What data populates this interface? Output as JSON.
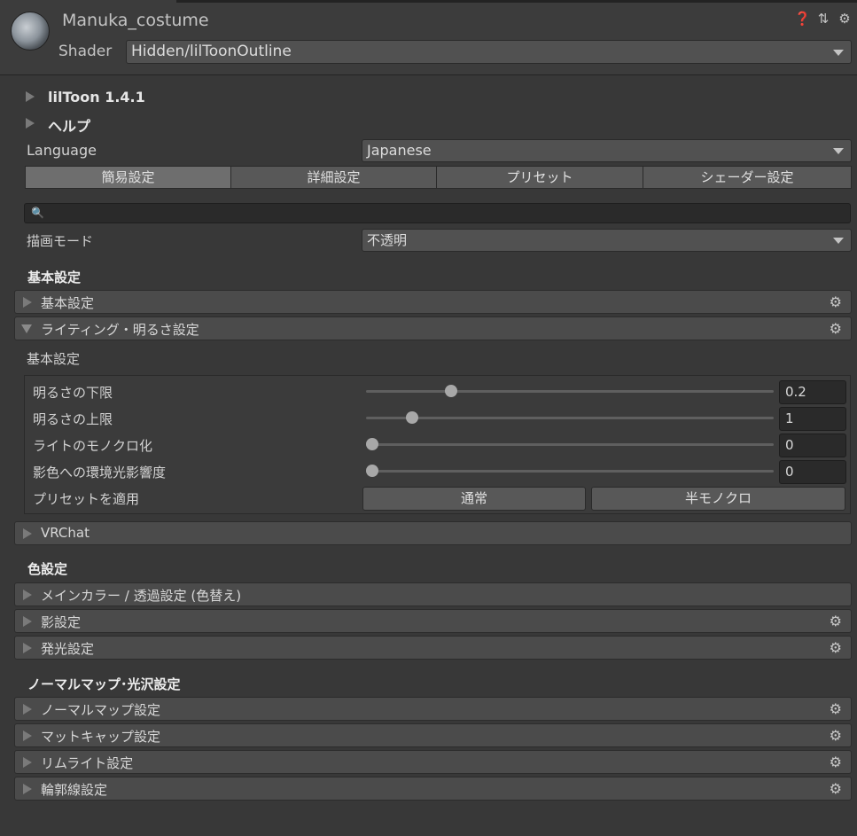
{
  "header": {
    "title": "Manuka_costume",
    "shader_label": "Shader",
    "shader_value": "Hidden/lilToonOutline",
    "icons": [
      "help-icon",
      "preset-icon",
      "settings-icon"
    ]
  },
  "foldouts": {
    "version": "lilToon 1.4.1",
    "help": "ヘルプ"
  },
  "language": {
    "label": "Language",
    "value": "Japanese"
  },
  "tabs": [
    {
      "label": "簡易設定",
      "active": true
    },
    {
      "label": "詳細設定",
      "active": false
    },
    {
      "label": "プリセット",
      "active": false
    },
    {
      "label": "シェーダー設定",
      "active": false
    }
  ],
  "render_mode": {
    "label": "描画モード",
    "value": "不透明"
  },
  "basic_section": {
    "title": "基本設定",
    "bars": {
      "basic": "基本設定",
      "lighting": "ライティング・明るさ設定"
    }
  },
  "lighting": {
    "subheader": "基本設定",
    "sliders": [
      {
        "label": "明るさの下限",
        "value": "0.2",
        "fraction": 0.2
      },
      {
        "label": "明るさの上限",
        "value": "1",
        "fraction": 0.1
      },
      {
        "label": "ライトのモノクロ化",
        "value": "0",
        "fraction": 0.0
      },
      {
        "label": "影色への環境光影響度",
        "value": "0",
        "fraction": 0.0
      }
    ],
    "preset_label": "プリセットを適用",
    "preset_buttons": [
      "通常",
      "半モノクロ"
    ]
  },
  "vrchat": "VRChat",
  "color_section": {
    "title": "色設定",
    "bars": [
      "メインカラー / 透過設定 (色替え)",
      "影設定",
      "発光設定"
    ]
  },
  "normal_section": {
    "title": "ノーマルマップ･光沢設定",
    "bars": [
      "ノーマルマップ設定",
      "マットキャップ設定",
      "リムライト設定",
      "輪郭線設定"
    ]
  },
  "colors": {
    "background": "#383838",
    "bar": "#4b4b4b",
    "field": "#2a2a2a",
    "text": "#d2d2d2"
  }
}
